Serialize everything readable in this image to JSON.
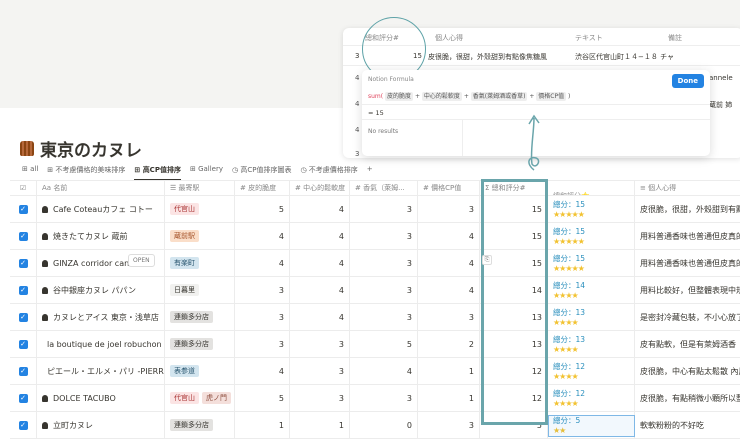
{
  "page": {
    "title": "東京のカヌレ"
  },
  "tabs": [
    {
      "label": "all",
      "icon": "table-icon"
    },
    {
      "label": "不考慮價格的美味排序",
      "icon": "table-icon"
    },
    {
      "label": "高CP值排序",
      "icon": "table-icon",
      "active": true
    },
    {
      "label": "Gallery",
      "icon": "gallery-icon"
    },
    {
      "label": "高CP值排序圖表",
      "icon": "clock-icon"
    },
    {
      "label": "不考慮價格排序",
      "icon": "clock-icon"
    },
    {
      "label": "+",
      "icon": "add-icon"
    }
  ],
  "columns": [
    "名前",
    "最寄駅",
    "皮的脆度",
    "中心的鬆軟度",
    "香氣（萊姆...",
    "價格CP值",
    "總和評分#",
    "總和評分⭐",
    "個人心得"
  ],
  "column_icons": [
    "Aa",
    "☰",
    "#",
    "#",
    "#",
    "#",
    "Σ",
    "Σ",
    "≡"
  ],
  "score_prefix": "總分：",
  "rows": [
    {
      "name": "Cafe Coteauカフェ コトー",
      "tags": [
        {
          "t": "代官山",
          "c": "#fbe4e4",
          "f": "#a33"
        }
      ],
      "v": [
        5,
        4,
        3,
        3
      ],
      "sum": 15,
      "stars": 5,
      "note": "皮很脆，很甜，外殼甜到有點像焦糖風"
    },
    {
      "name": "焼きたてカヌレ 蔵前",
      "tags": [
        {
          "t": "蔵前駅",
          "c": "#fadec9",
          "f": "#a5542a"
        }
      ],
      "v": [
        4,
        4,
        3,
        4
      ],
      "sum": 15,
      "stars": 5,
      "note": "用料普通香味也普通但皮真的很"
    },
    {
      "name": "GINZA corridor cannele",
      "tags": [
        {
          "t": "有楽町",
          "c": "#d3e5ef",
          "f": "#28556f"
        }
      ],
      "v": [
        4,
        4,
        3,
        4
      ],
      "sum": 15,
      "stars": 5,
      "note": "用料普通香味也普通但皮真的很"
    },
    {
      "name": "谷中銀座カヌレ パパン",
      "tags": [
        {
          "t": "日暮里",
          "c": "#f1f1ef",
          "f": "#37352f"
        }
      ],
      "v": [
        3,
        4,
        3,
        4
      ],
      "sum": 14,
      "stars": 4,
      "note": "用料比較好，但整體表現中規中"
    },
    {
      "name": "カヌレとアイス 東京・浅草店",
      "tags": [
        {
          "t": "連鎖多分店",
          "c": "#e3e2e0",
          "f": "#37352f"
        }
      ],
      "v": [
        3,
        4,
        3,
        3
      ],
      "sum": 13,
      "stars": 4,
      "note": "是密封冷藏包裝，不小心放了兩"
    },
    {
      "name": "la boutique de joel robuchon",
      "tags": [
        {
          "t": "連鎖多分店",
          "c": "#e3e2e0",
          "f": "#37352f"
        }
      ],
      "v": [
        3,
        3,
        5,
        2
      ],
      "sum": 13,
      "stars": 4,
      "note": "皮有點軟，但是有萊姆酒香"
    },
    {
      "name": "ピエール・エルメ・パリ -PIERRE HERMÉ",
      "tags": [
        {
          "t": "表参道",
          "c": "#d3e5ef",
          "f": "#28556f"
        }
      ],
      "v": [
        4,
        3,
        4,
        1
      ],
      "sum": 12,
      "stars": 4,
      "note": "皮很脆，中心有點太鬆散 內用是"
    },
    {
      "name": "DOLCE TACUBO",
      "tags": [
        {
          "t": "代官山",
          "c": "#fbe4e4",
          "f": "#a33"
        },
        {
          "t": "虎ノ門",
          "c": "#f4dfdb",
          "f": "#8a4a3a"
        }
      ],
      "v": [
        5,
        3,
        3,
        1
      ],
      "sum": 12,
      "stars": 4,
      "note": "皮很脆，有點稍微小顆所以整體"
    },
    {
      "name": "立町カヌレ",
      "tags": [
        {
          "t": "連鎖多分店",
          "c": "#e3e2e0",
          "f": "#37352f"
        }
      ],
      "v": [
        1,
        1,
        0,
        3
      ],
      "sum": 5,
      "stars": 2,
      "note": "軟軟粉粉的不好吃"
    }
  ],
  "open_label": "OPEN",
  "overlay": {
    "headers": [
      "總和評分#",
      "個人心得",
      "テキスト",
      "備註"
    ],
    "row": {
      "sum": "15",
      "note": "皮很脆，很甜，外殼甜到有點像焦糖風",
      "address": "渋谷区代官山町１４−１８ チャ",
      "left": "3"
    },
    "side_values": [
      "4",
      "4",
      "4",
      "3"
    ],
    "peek": [
      "annele",
      "蔵前 姉"
    ],
    "formula_label": "Notion Formula",
    "done": "Done",
    "fn": "sum(",
    "tokens": [
      "皮的脆度",
      "中心的鬆軟度",
      "香氣(萊姆酒或香草)",
      "價格CP值"
    ],
    "result": "15",
    "no_results": "No results"
  },
  "colors": {
    "accent": "#2383e2",
    "highlight": "#6aa5ab",
    "star": "#f2c230"
  }
}
